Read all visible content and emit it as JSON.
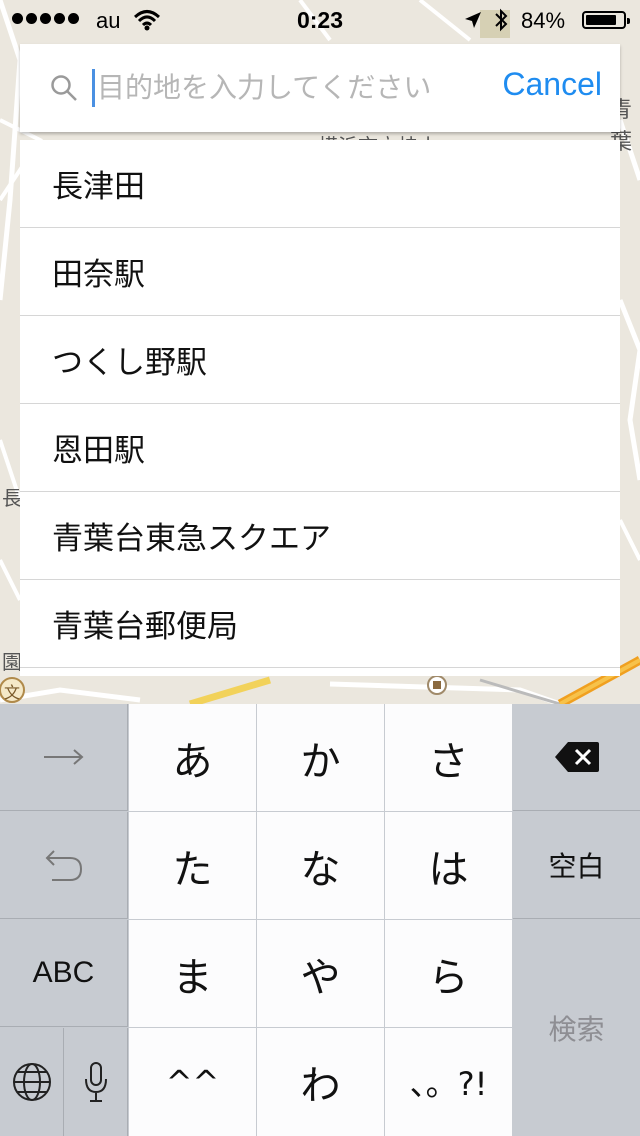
{
  "status_bar": {
    "carrier": "au",
    "time": "0:23",
    "battery_percent": "84%",
    "battery_level": 0.84
  },
  "search": {
    "placeholder": "目的地を入力してください",
    "value": "",
    "cancel_label": "Cancel"
  },
  "suggestions": [
    "長津田",
    "田奈駅",
    "つくし野駅",
    "恩田駅",
    "青葉台東急スクエア",
    "青葉台郵便局"
  ],
  "keyboard": {
    "row1": [
      "あ",
      "か",
      "さ"
    ],
    "row2": [
      "た",
      "な",
      "は"
    ],
    "row3": [
      "ま",
      "や",
      "ら"
    ],
    "row4": [
      "^^",
      "わ",
      "、。?!"
    ],
    "space_label": "空白",
    "abc_label": "ABC",
    "search_label": "検索"
  },
  "map": {
    "labels": [
      "横浜市立桂小",
      "青葉",
      "長",
      "園",
      "文"
    ]
  },
  "colors": {
    "accent": "#1f8cf0",
    "keyboard_bg": "#c7cbd1",
    "key_bg": "#fcfcfd"
  }
}
